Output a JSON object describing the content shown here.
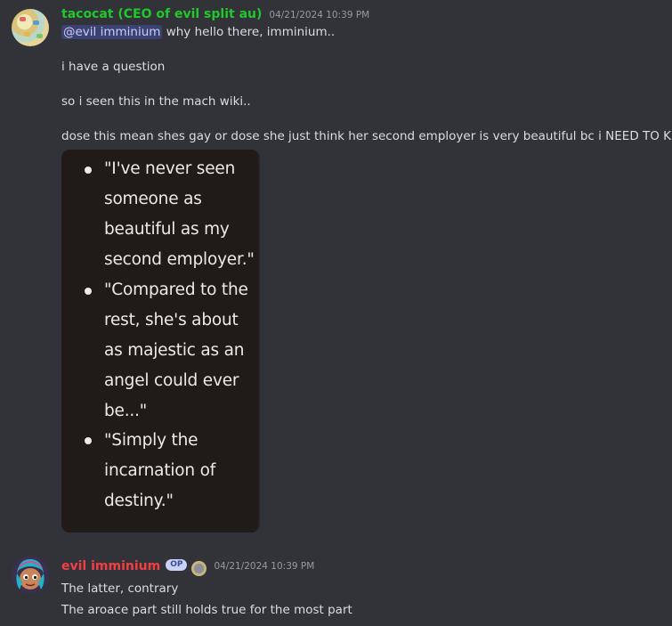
{
  "messages": [
    {
      "author": "tacocat (CEO of evil split au)",
      "author_color": "#21c72b",
      "timestamp": "04/21/2024 10:39 PM",
      "mention": "@evil imminium",
      "lines": [
        "why hello there, imminium..",
        "i have a question",
        "so i seen this in the mach wiki..",
        "dose this mean shes gay or dose she just think her second employer is very beautiful bc i NEED TO KNOW"
      ],
      "embed_lines": [
        "\"I've never seen",
        "someone as",
        "beautiful as my",
        "second employer.\"",
        "\"Compared to the",
        "rest, she's about",
        "as majestic as an",
        "angel could ever",
        "be...\"",
        "\"Simply the",
        "incarnation of",
        "destiny.\""
      ]
    },
    {
      "author": "evil imminium",
      "author_color": "#f23f43",
      "badge": "OP",
      "timestamp": "04/21/2024 10:39 PM",
      "lines": [
        "The latter, contrary",
        "The aroace part still holds true for the most part"
      ]
    }
  ]
}
